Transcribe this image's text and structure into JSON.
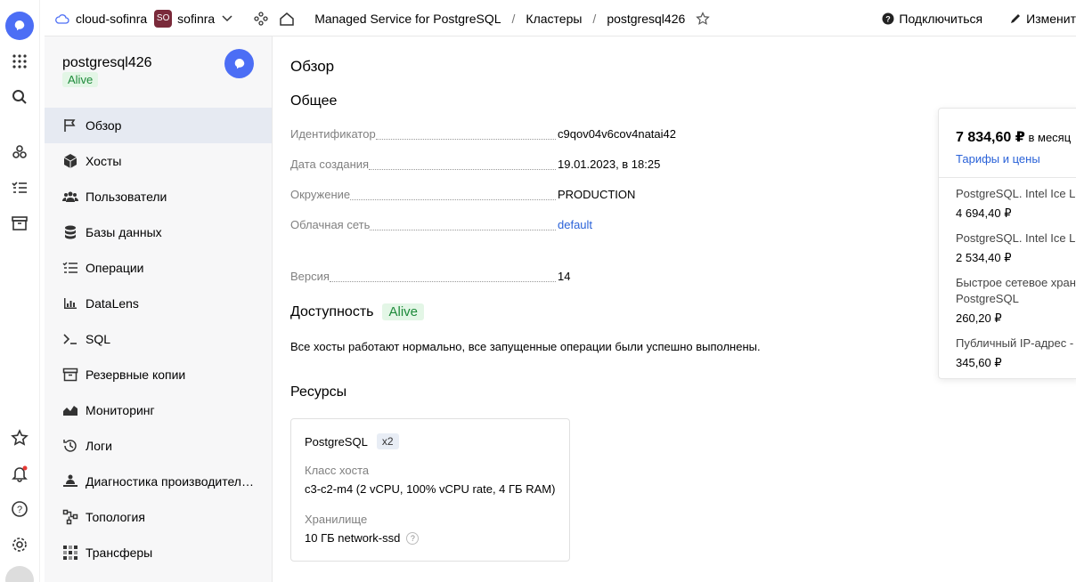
{
  "header": {
    "cloud": "cloud-sofinra",
    "folder_tag": "SO",
    "folder": "sofinra",
    "breadcrumbs": [
      "Managed Service for PostgreSQL",
      "Кластеры",
      "postgresql426"
    ],
    "connect_label": "Подключиться",
    "edit_label": "Изменит"
  },
  "cluster": {
    "name": "postgresql426",
    "status": "Alive"
  },
  "nav": {
    "items": [
      {
        "label": "Обзор",
        "icon": "flag-icon"
      },
      {
        "label": "Хосты",
        "icon": "cube-icon"
      },
      {
        "label": "Пользователи",
        "icon": "users-icon"
      },
      {
        "label": "Базы данных",
        "icon": "database-icon"
      },
      {
        "label": "Операции",
        "icon": "checklist-icon"
      },
      {
        "label": "DataLens",
        "icon": "chart-icon"
      },
      {
        "label": "SQL",
        "icon": "terminal-icon"
      },
      {
        "label": "Резервные копии",
        "icon": "archive-icon"
      },
      {
        "label": "Мониторинг",
        "icon": "monitoring-icon"
      },
      {
        "label": "Логи",
        "icon": "history-icon"
      },
      {
        "label": "Диагностика производитель...",
        "icon": "diagnostics-icon"
      },
      {
        "label": "Топология",
        "icon": "topology-icon"
      },
      {
        "label": "Трансферы",
        "icon": "transfer-icon"
      }
    ]
  },
  "overview": {
    "title": "Обзор",
    "general_title": "Общее",
    "fields": {
      "id_label": "Идентификатор",
      "id_value": "c9qov04v6cov4natai42",
      "created_label": "Дата создания",
      "created_value": "19.01.2023, в 18:25",
      "env_label": "Окружение",
      "env_value": "PRODUCTION",
      "network_label": "Облачная сеть",
      "network_value": "default",
      "version_label": "Версия",
      "version_value": "14"
    },
    "availability_title": "Доступность",
    "availability_status": "Alive",
    "availability_desc": "Все хосты работают нормально, все запущенные операции были успешно выполнены.",
    "resources_title": "Ресурсы",
    "resource_card": {
      "name": "PostgreSQL",
      "count": "x2",
      "host_class_label": "Класс хоста",
      "host_class_value": "c3-c2-m4 (2 vCPU, 100% vCPU rate, 4 ГБ RAM)",
      "storage_label": "Хранилище",
      "storage_value": "10 ГБ network-ssd",
      "help": "?"
    }
  },
  "pricing": {
    "total": "7 834,60 ₽",
    "period": "в месяц",
    "tariff_link": "Тарифы и цены",
    "items": [
      {
        "label": "PostgreSQL. Intel Ice La",
        "amount": "4 694,40 ₽"
      },
      {
        "label": "PostgreSQL. Intel Ice La",
        "amount": "2 534,40 ₽"
      },
      {
        "label": "Быстрое сетевое хран",
        "label2": "PostgreSQL",
        "amount": "260,20 ₽"
      },
      {
        "label": "Публичный IP-адрес -",
        "amount": "345,60 ₽"
      }
    ]
  },
  "colors": {
    "accent": "#4c6ef5",
    "link": "#2a62d8",
    "alive_text": "#1d8a3a",
    "alive_bg": "#e3f6e6",
    "active_nav": "#e6eaf2"
  }
}
